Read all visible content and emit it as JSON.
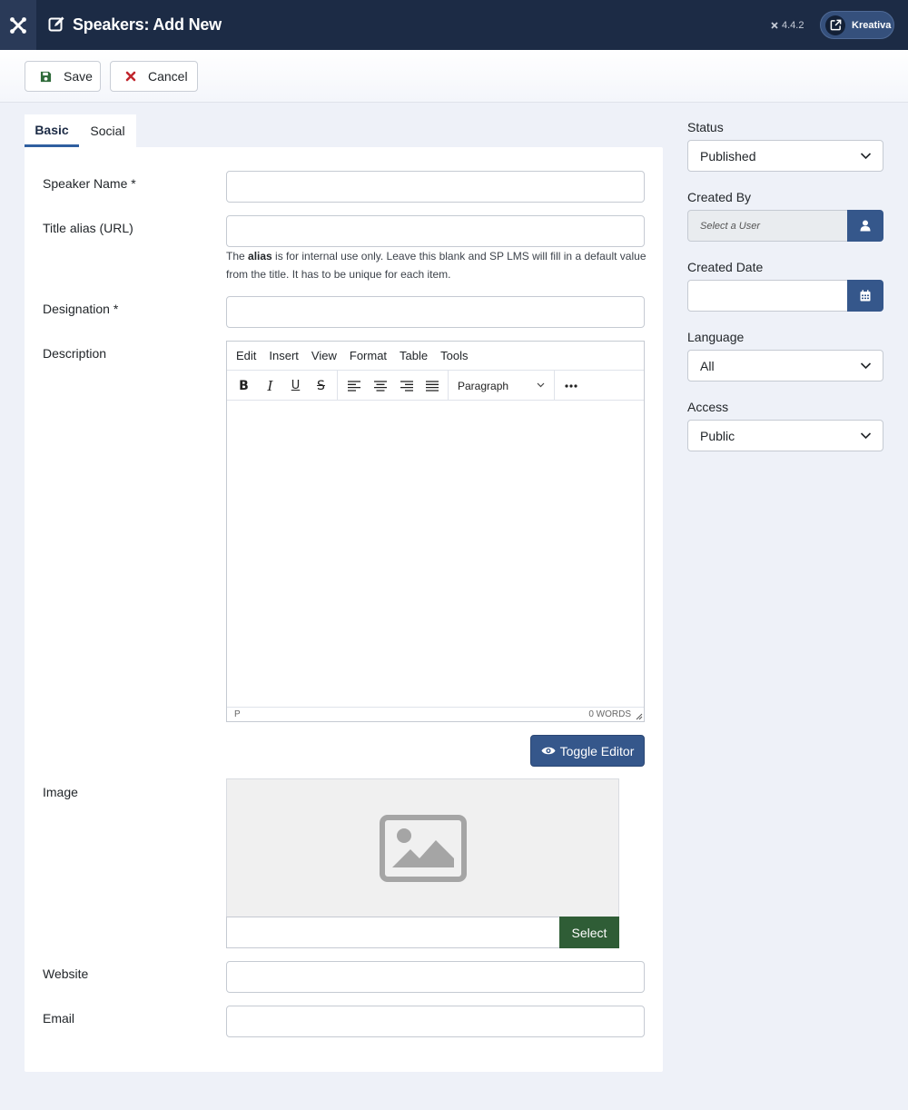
{
  "header": {
    "title": "Speakers: Add New",
    "version": "4.4.2",
    "site_label": "Kreativa"
  },
  "toolbar": {
    "save_label": "Save",
    "cancel_label": "Cancel"
  },
  "tabs": [
    {
      "label": "Basic",
      "active": true
    },
    {
      "label": "Social",
      "active": false
    }
  ],
  "form": {
    "speaker_name_label": "Speaker Name *",
    "speaker_name_value": "",
    "title_alias_label": "Title alias (URL)",
    "title_alias_value": "",
    "alias_help_pre": "The ",
    "alias_help_bold": "alias",
    "alias_help_post": " is for internal use only. Leave this blank and SP LMS will fill in a default value from the title. It has to be unique for each item.",
    "designation_label": "Designation *",
    "designation_value": "",
    "description_label": "Description",
    "image_label": "Image",
    "image_select_label": "Select",
    "website_label": "Website",
    "website_value": "",
    "email_label": "Email",
    "email_value": ""
  },
  "editor": {
    "menu": [
      "Edit",
      "Insert",
      "View",
      "Format",
      "Table",
      "Tools"
    ],
    "block_format": "Paragraph",
    "status_path": "P",
    "word_count": "0 WORDS",
    "toggle_label": "Toggle Editor"
  },
  "sidebar": {
    "status_label": "Status",
    "status_value": "Published",
    "created_by_label": "Created By",
    "created_by_placeholder": "Select a User",
    "created_date_label": "Created Date",
    "created_date_value": "",
    "language_label": "Language",
    "language_value": "All",
    "access_label": "Access",
    "access_value": "Public"
  },
  "colors": {
    "header_bg": "#1c2b45",
    "primary": "#35578b",
    "success": "#2f5d36",
    "danger": "#c0262d"
  }
}
